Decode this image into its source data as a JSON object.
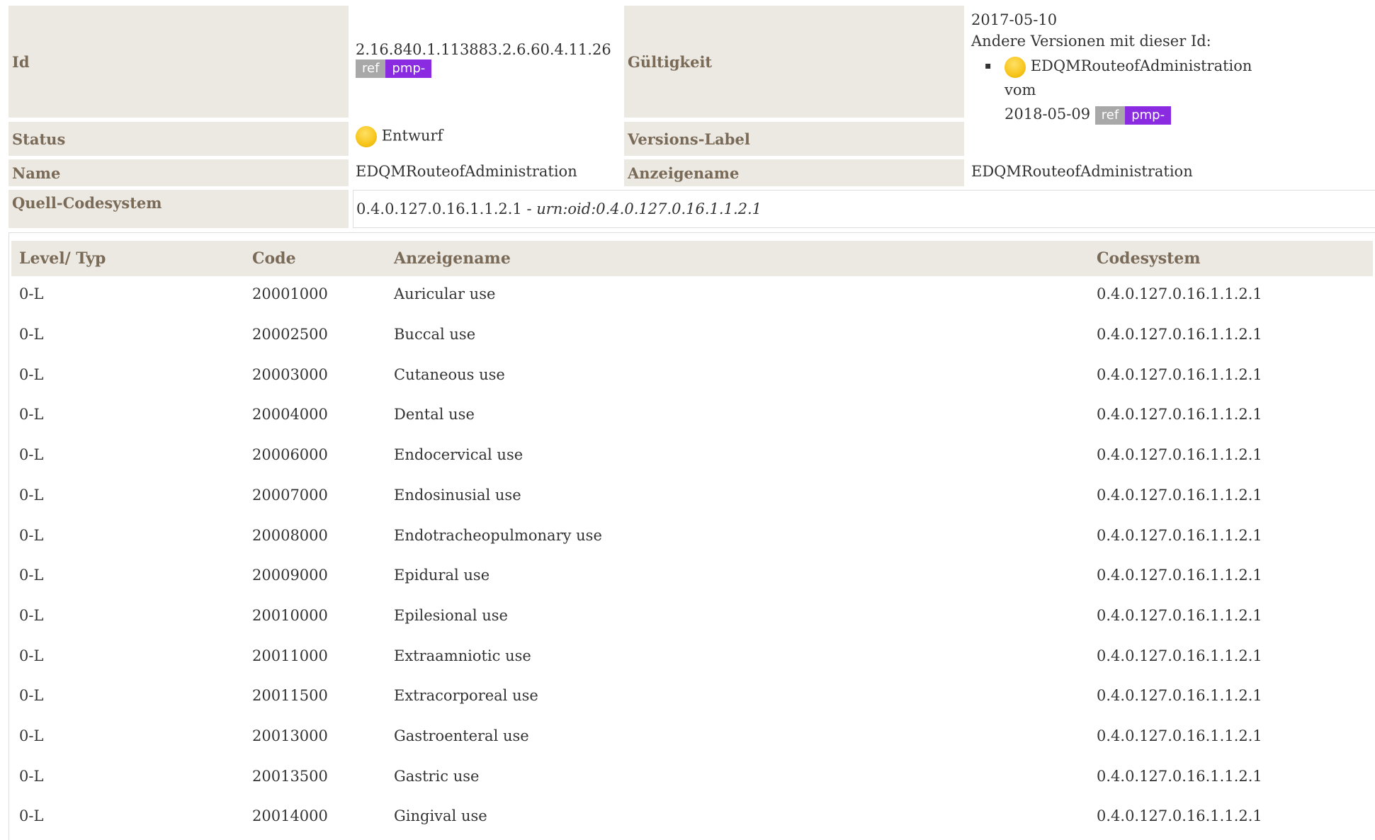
{
  "meta": {
    "id_label": "Id",
    "id_value": "2.16.840.1.113883.2.6.60.4.11.26",
    "badge_ref": "ref",
    "badge_pmp": "pmp-",
    "validity_label": "Gültigkeit",
    "validity_date": "2017-05-10",
    "other_versions_label": "Andere Versionen mit dieser Id:",
    "other_version_name": "EDQMRouteofAdministration vom",
    "other_version_date": "2018-05-09",
    "status_label": "Status",
    "status_value": "Entwurf",
    "status_icon": "draft-sun-icon",
    "version_label_label": "Versions-Label",
    "version_label_value": "",
    "name_label": "Name",
    "name_value": "EDQMRouteofAdministration",
    "display_name_label": "Anzeigename",
    "display_name_value": "EDQMRouteofAdministration",
    "source_codesystem_label": "Quell-Codesystem",
    "source_codesystem_oid": "0.4.0.127.0.16.1.1.2.1",
    "source_codesystem_sep": " - ",
    "source_codesystem_urn": "urn:oid:0.4.0.127.0.16.1.1.2.1"
  },
  "table": {
    "headers": [
      "Level/ Typ",
      "Code",
      "Anzeigename",
      "Codesystem"
    ],
    "rows": [
      {
        "level": "0-L",
        "code": "20001000",
        "name": "Auricular use",
        "system": "0.4.0.127.0.16.1.1.2.1"
      },
      {
        "level": "0-L",
        "code": "20002500",
        "name": "Buccal use",
        "system": "0.4.0.127.0.16.1.1.2.1"
      },
      {
        "level": "0-L",
        "code": "20003000",
        "name": "Cutaneous use",
        "system": "0.4.0.127.0.16.1.1.2.1"
      },
      {
        "level": "0-L",
        "code": "20004000",
        "name": "Dental use",
        "system": "0.4.0.127.0.16.1.1.2.1"
      },
      {
        "level": "0-L",
        "code": "20006000",
        "name": "Endocervical use",
        "system": "0.4.0.127.0.16.1.1.2.1"
      },
      {
        "level": "0-L",
        "code": "20007000",
        "name": "Endosinusial use",
        "system": "0.4.0.127.0.16.1.1.2.1"
      },
      {
        "level": "0-L",
        "code": "20008000",
        "name": "Endotracheopulmonary use",
        "system": "0.4.0.127.0.16.1.1.2.1"
      },
      {
        "level": "0-L",
        "code": "20009000",
        "name": "Epidural use",
        "system": "0.4.0.127.0.16.1.1.2.1"
      },
      {
        "level": "0-L",
        "code": "20010000",
        "name": "Epilesional use",
        "system": "0.4.0.127.0.16.1.1.2.1"
      },
      {
        "level": "0-L",
        "code": "20011000",
        "name": "Extraamniotic use",
        "system": "0.4.0.127.0.16.1.1.2.1"
      },
      {
        "level": "0-L",
        "code": "20011500",
        "name": "Extracorporeal use",
        "system": "0.4.0.127.0.16.1.1.2.1"
      },
      {
        "level": "0-L",
        "code": "20013000",
        "name": "Gastroenteral use",
        "system": "0.4.0.127.0.16.1.1.2.1"
      },
      {
        "level": "0-L",
        "code": "20013500",
        "name": "Gastric use",
        "system": "0.4.0.127.0.16.1.1.2.1"
      },
      {
        "level": "0-L",
        "code": "20014000",
        "name": "Gingival use",
        "system": "0.4.0.127.0.16.1.1.2.1"
      }
    ]
  }
}
